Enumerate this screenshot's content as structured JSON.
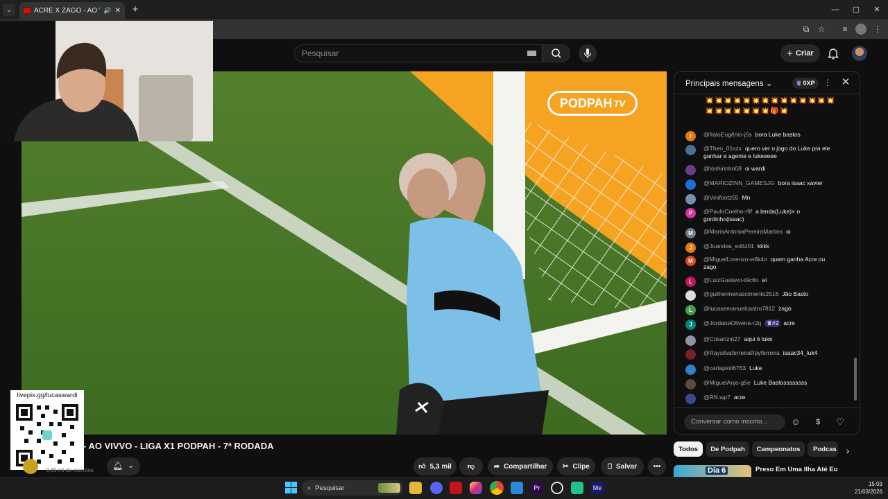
{
  "browser": {
    "tab_title": "ACRE X ZAGO - AO VIVVO",
    "new_tab": "+",
    "window_controls": [
      "—",
      "▢",
      "✕"
    ]
  },
  "youtube": {
    "search_placeholder": "Pesquisar",
    "create_label": "Criar"
  },
  "overlay": {
    "brand": "PODPAH",
    "brand_suffix": "TV",
    "qr_label": "livepix.gg/lucaswardi"
  },
  "video": {
    "title": "- AO VIVVO - LIGA X1 PODPAH - 7ª RODADA",
    "subscribers": "9,85 mi de inscritos",
    "likes": "5,3 mil",
    "share_label": "Compartilhar",
    "clip_label": "Clipe",
    "save_label": "Salvar",
    "more_label": "•••"
  },
  "chat": {
    "title": "Principais mensagens",
    "xp_label": "0XP",
    "emoji_rows": "💥💥💥💥💥💥💥💥💥💥💥💥💥💥💥💥💥💥💥💥💥🎁💥",
    "input_placeholder": "Conversar como inscrito...",
    "messages": [
      {
        "author": "@ÍtaloEugênio-j5s",
        "text": "bora Luke bastos",
        "initial": "I",
        "color": "#e37b12"
      },
      {
        "author": "@Theo_01szx",
        "text": "quero ver o jogo do Luke pra ele ganhar e agente e lukeeeee",
        "initial": "",
        "color": "#4a6e9a"
      },
      {
        "author": "@toshirinho08",
        "text": "oi wardi",
        "initial": "",
        "color": "#6a3d8a"
      },
      {
        "author": "@MARIOZINN_GAMESJG",
        "text": "bora isaac xavier",
        "initial": "",
        "color": "#1f6ed6"
      },
      {
        "author": "@Vinifootz55",
        "text": "Mn",
        "initial": "",
        "color": "#7a8fb0"
      },
      {
        "author": "@PauloCoelho-r9f",
        "text": "a lenda(Luke)× o gordinho(isaac)",
        "initial": "P",
        "color": "#d6339f"
      },
      {
        "author": "@MariaAntoniaPereiraMartins",
        "text": "oi",
        "initial": "M",
        "color": "#6f7c8a"
      },
      {
        "author": "@Juandas_editz01",
        "text": "kkkk",
        "initial": "J",
        "color": "#e37b12"
      },
      {
        "author": "@MiguelLorenzo-w6k4o",
        "text": "quem ganha Acre ou zago",
        "initial": "M",
        "color": "#e0481e"
      },
      {
        "author": "@LuizGustavo-t9c6o",
        "text": "ei",
        "initial": "L",
        "color": "#c2185b"
      },
      {
        "author": "@guilhermenascimento2516",
        "text": "Jão Basto",
        "initial": "",
        "color": "#dddddd"
      },
      {
        "author": "@lucasemanuelcastro7812",
        "text": "zago",
        "initial": "L",
        "color": "#43a047"
      },
      {
        "author": "@JordanaOliveira-r2q",
        "text": "acre",
        "initial": "J",
        "color": "#00897b",
        "badge": "♛#2"
      },
      {
        "author": "@Crisanzin27",
        "text": "aqui é luke",
        "initial": "",
        "color": "#8a94a6"
      },
      {
        "author": "@RaysilvaferreiraRayferreira",
        "text": "isaac34_luk4",
        "initial": "",
        "color": "#7a1f2a"
      },
      {
        "author": "@carlapioli6763",
        "text": "Luke",
        "initial": "",
        "color": "#2f7fd1"
      },
      {
        "author": "@MiguelAnjo-g5e",
        "text": "Luke Bastossssssss",
        "initial": "",
        "color": "#5b4a3f"
      },
      {
        "author": "@RN.wp7",
        "text": "acre",
        "initial": "",
        "color": "#3b4a8f"
      }
    ]
  },
  "chips": [
    "Todos",
    "De Podpah",
    "Campeonatos",
    "Podcas"
  ],
  "recommended": {
    "thumb_text": "Dia 6",
    "title": "Preso Em Uma Ilha Até Eu"
  },
  "taskbar": {
    "search_label": "Pesquisar",
    "time": "15:03",
    "date": "21/03/2026"
  }
}
